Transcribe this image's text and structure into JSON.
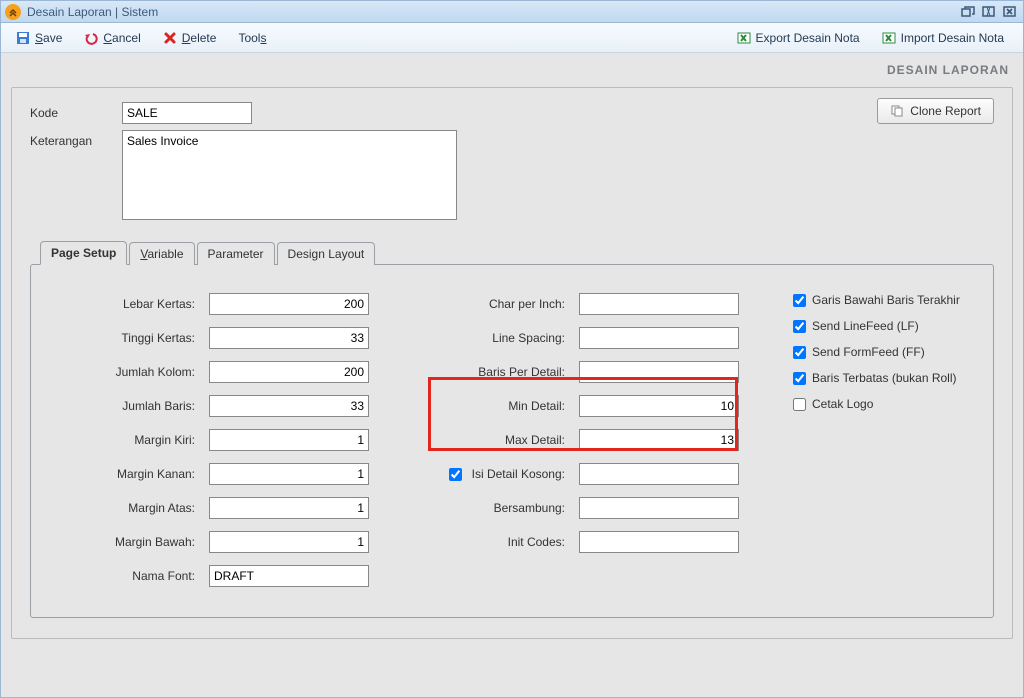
{
  "window": {
    "title": "Desain Laporan | Sistem"
  },
  "toolbar": {
    "save": "Save",
    "cancel": "Cancel",
    "delete": "Delete",
    "tools": "Tools",
    "export": "Export Desain Nota",
    "import": "Import Desain Nota"
  },
  "section_title": "DESAIN LAPORAN",
  "header": {
    "kode_label": "Kode",
    "kode_value": "SALE",
    "ket_label": "Keterangan",
    "ket_value": "Sales Invoice",
    "clone_label": "Clone Report"
  },
  "tabs": {
    "page_setup": "Page Setup",
    "variable": "Variable",
    "parameter": "Parameter",
    "design_layout": "Design Layout"
  },
  "page_setup": {
    "col1": {
      "lebar_kertas_label": "Lebar Kertas:",
      "lebar_kertas_value": "200",
      "tinggi_kertas_label": "Tinggi Kertas:",
      "tinggi_kertas_value": "33",
      "jumlah_kolom_label": "Jumlah Kolom:",
      "jumlah_kolom_value": "200",
      "jumlah_baris_label": "Jumlah Baris:",
      "jumlah_baris_value": "33",
      "margin_kiri_label": "Margin Kiri:",
      "margin_kiri_value": "1",
      "margin_kanan_label": "Margin Kanan:",
      "margin_kanan_value": "1",
      "margin_atas_label": "Margin Atas:",
      "margin_atas_value": "1",
      "margin_bawah_label": "Margin Bawah:",
      "margin_bawah_value": "1",
      "nama_font_label": "Nama Font:",
      "nama_font_value": "DRAFT"
    },
    "col2": {
      "cpi_label": "Char per Inch:",
      "cpi_value": "",
      "line_spacing_label": "Line Spacing:",
      "line_spacing_value": "",
      "baris_per_detail_label": "Baris Per Detail:",
      "baris_per_detail_value": "",
      "min_detail_label": "Min Detail:",
      "min_detail_value": "10",
      "max_detail_label": "Max Detail:",
      "max_detail_value": "13",
      "isi_detail_kosong_label": "Isi Detail Kosong:",
      "isi_detail_kosong_value": "",
      "bersambung_label": "Bersambung:",
      "bersambung_value": "",
      "init_codes_label": "Init Codes:",
      "init_codes_value": ""
    },
    "col3": {
      "garis_bawah": "Garis Bawahi Baris Terakhir",
      "send_lf": "Send LineFeed (LF)",
      "send_ff": "Send FormFeed (FF)",
      "baris_terbatas": "Baris Terbatas (bukan Roll)",
      "cetak_logo": "Cetak Logo"
    }
  }
}
